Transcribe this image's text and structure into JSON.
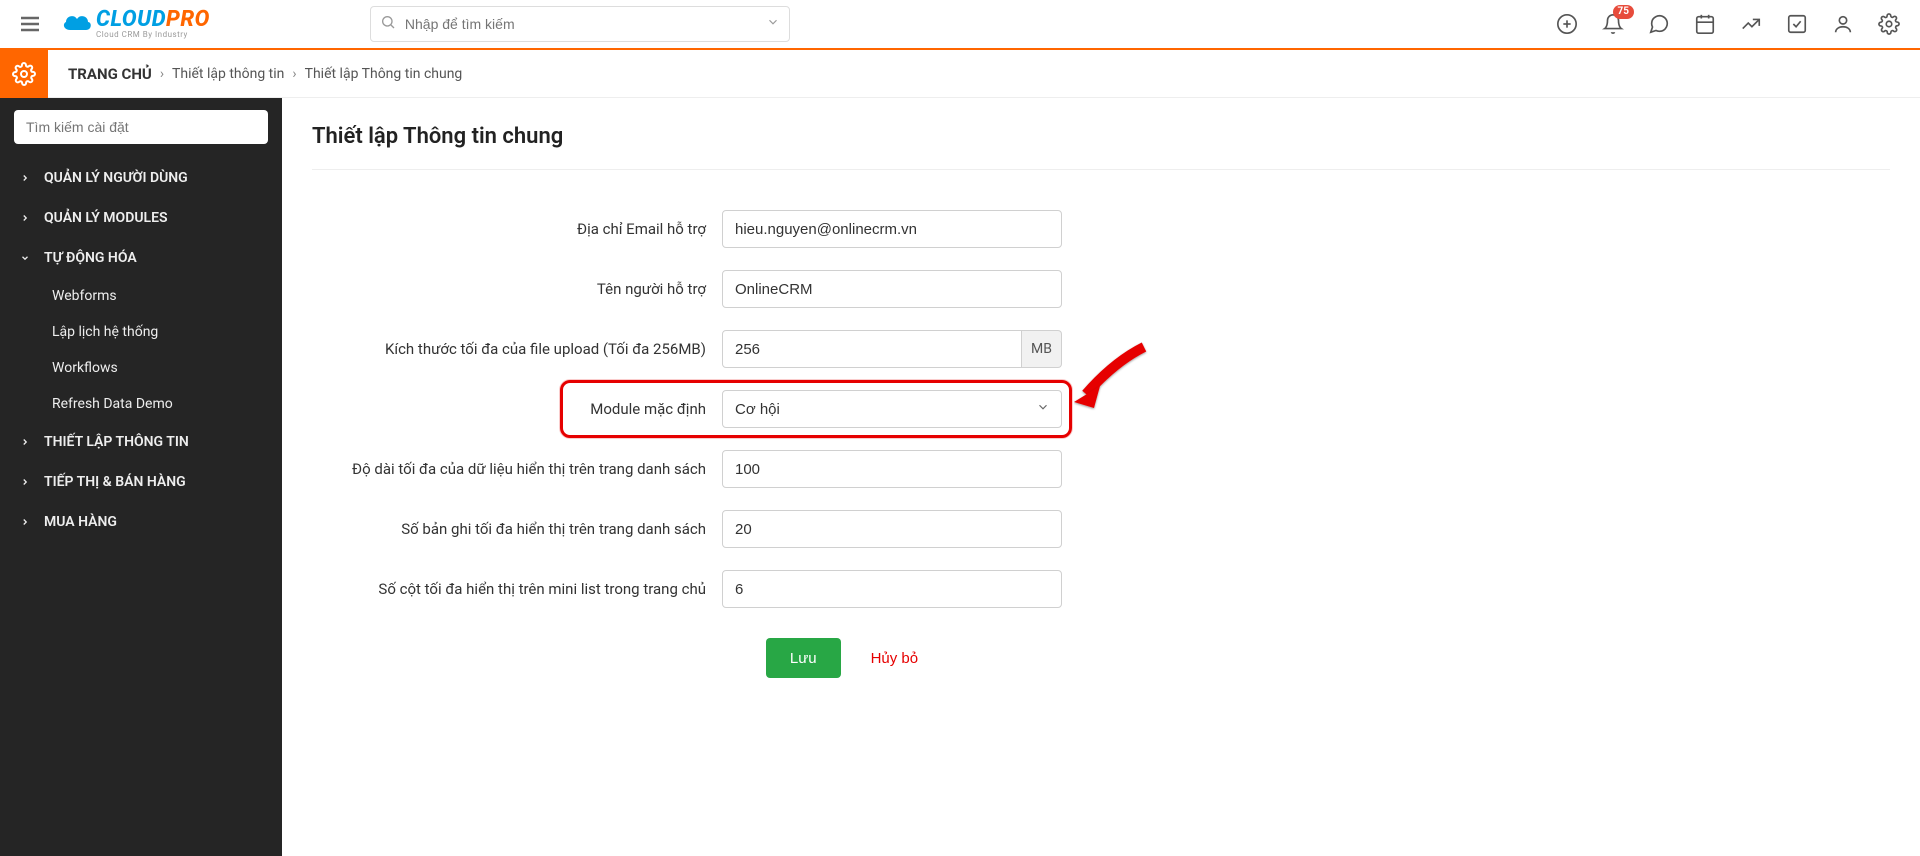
{
  "header": {
    "search_placeholder": "Nhập để tìm kiếm",
    "badge": "75"
  },
  "logo": {
    "cloud": "CLOUD",
    "pro": "PRO",
    "sub": "Cloud CRM By Industry"
  },
  "breadcrumb": {
    "home": "TRANG CHỦ",
    "l1": "Thiết lập thông tin",
    "l2": "Thiết lập Thông tin chung"
  },
  "sidebar": {
    "search_placeholder": "Tìm kiếm cài đặt",
    "items": {
      "users": "QUẢN LÝ NGƯỜI DÙNG",
      "modules": "QUẢN LÝ MODULES",
      "automation": "TỰ ĐỘNG HÓA",
      "sub_webforms": "Webforms",
      "sub_schedule": "Lập lịch hệ thống",
      "sub_workflows": "Workflows",
      "sub_refresh": "Refresh Data Demo",
      "info_setup": "THIẾT LẬP THÔNG TIN",
      "marketing": "TIẾP THỊ & BÁN HÀNG",
      "purchase": "MUA HÀNG"
    }
  },
  "page": {
    "title": "Thiết lập Thông tin chung"
  },
  "form": {
    "email_label": "Địa chỉ Email hỗ trợ",
    "email_value": "hieu.nguyen@onlinecrm.vn",
    "supporter_label": "Tên người hỗ trợ",
    "supporter_value": "OnlineCRM",
    "upload_label": "Kích thước tối đa của file upload (Tối đa 256MB)",
    "upload_value": "256",
    "upload_unit": "MB",
    "module_label": "Module mặc định",
    "module_value": "Cơ hội",
    "list_len_label": "Độ dài tối đa của dữ liệu hiển thị trên trang danh sách",
    "list_len_value": "100",
    "records_label": "Số bản ghi tối đa hiển thị trên trang danh sách",
    "records_value": "20",
    "cols_label": "Số cột tối đa hiển thị trên mini list trong trang chủ",
    "cols_value": "6"
  },
  "buttons": {
    "save": "Lưu",
    "cancel": "Hủy bỏ"
  }
}
